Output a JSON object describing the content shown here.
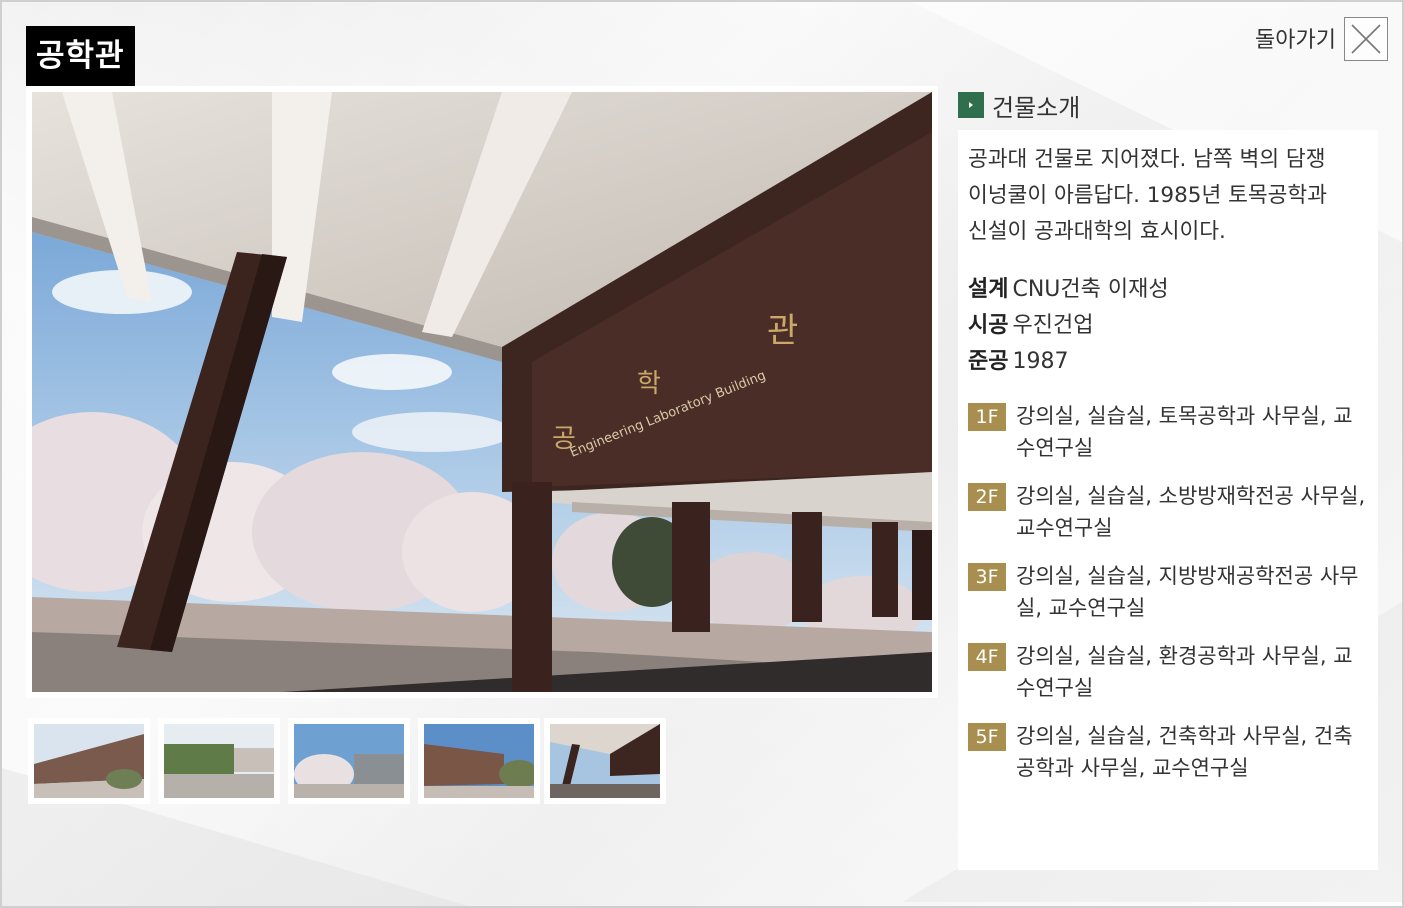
{
  "header": {
    "title": "공학관",
    "back_label": "돌아가기"
  },
  "icons": {
    "close": "close-x-icon",
    "section_marker": "chevron-right-icon"
  },
  "colors": {
    "title_bg": "#000000",
    "section_marker": "#2f6f4e",
    "floor_badge": "#a88f4f"
  },
  "photo": {
    "sign_chars": [
      "공",
      "학",
      "관"
    ],
    "sign_english": "Engineering Laboratory Building"
  },
  "info": {
    "section_title": "건물소개",
    "description": "공과대 건물로 지어졌다. 남쪽 벽의 담쟁이넝쿨이 아름답다. 1985년 토목공학과 신설이 공과대학의 효시이다.",
    "design_key": "설계",
    "design_value": "CNU건축 이재성",
    "construct_key": "시공",
    "construct_value": "우진건업",
    "complete_key": "준공",
    "complete_value": "1987",
    "floors": [
      {
        "badge": "1F",
        "text": "강의실, 실습실, 토목공학과 사무실, 교수연구실"
      },
      {
        "badge": "2F",
        "text": "강의실, 실습실, 소방방재학전공 사무실, 교수연구실"
      },
      {
        "badge": "3F",
        "text": "강의실, 실습실, 지방방재공학전공 사무실, 교수연구실"
      },
      {
        "badge": "4F",
        "text": "강의실, 실습실, 환경공학과 사무실, 교수연구실"
      },
      {
        "badge": "5F",
        "text": "강의실, 실습실, 건축학과 사무실, 건축공학과 사무실, 교수연구실"
      }
    ]
  }
}
